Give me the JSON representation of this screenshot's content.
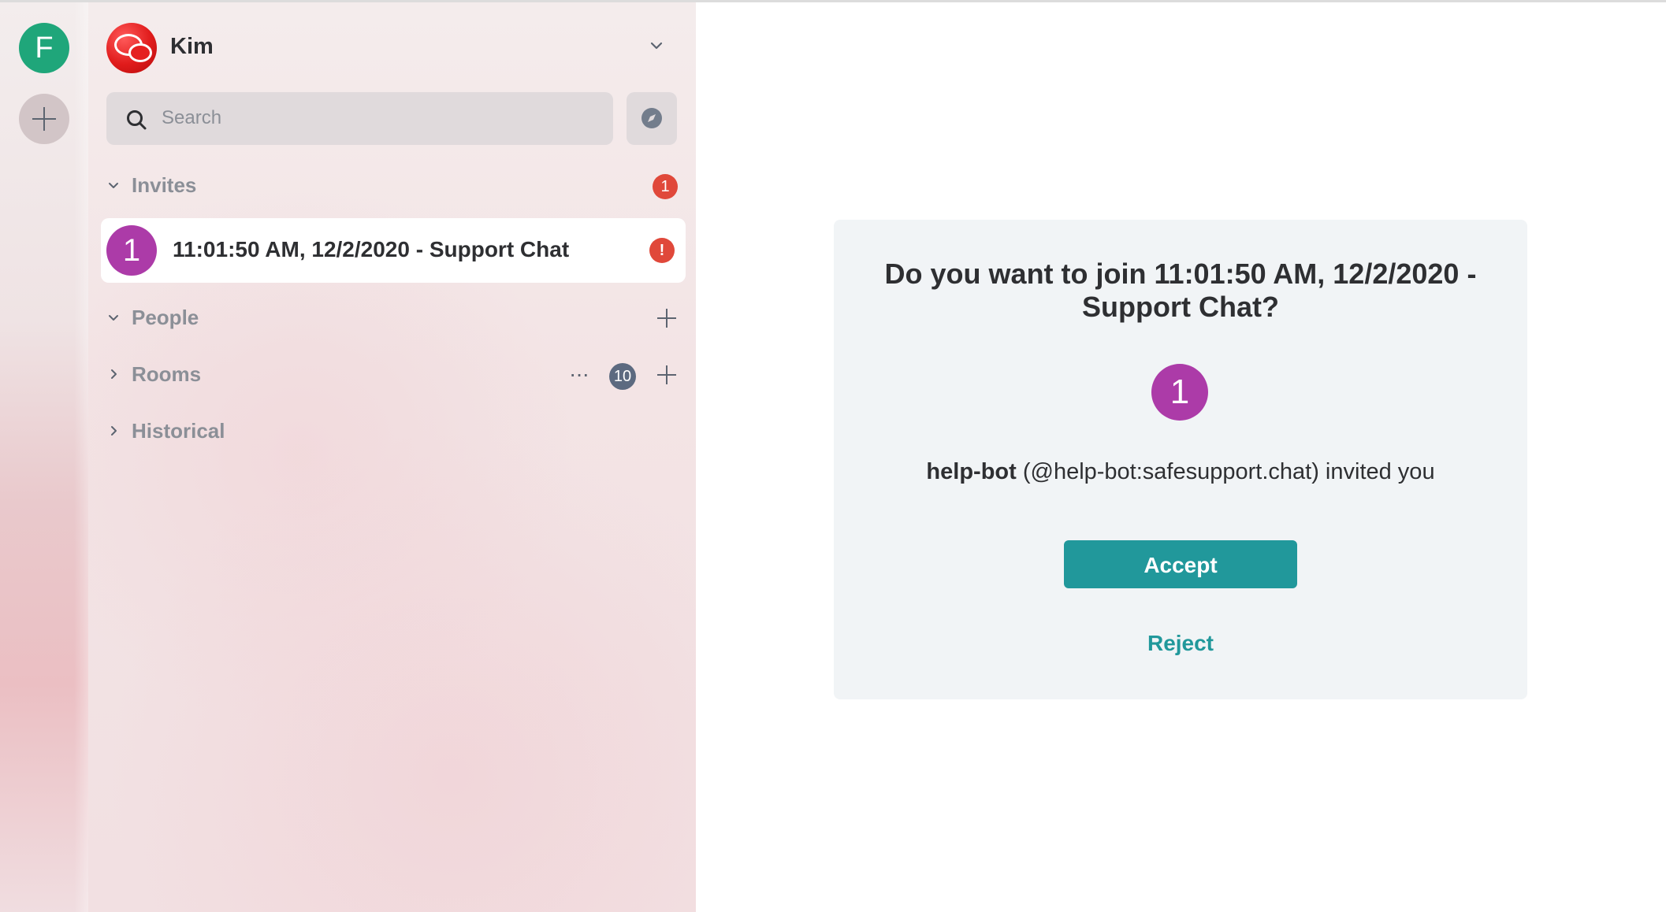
{
  "spaces": {
    "home_initial": "F"
  },
  "user": {
    "name": "Kim"
  },
  "search": {
    "placeholder": "Search"
  },
  "sections": {
    "invites": {
      "label": "Invites",
      "badge": "1"
    },
    "people": {
      "label": "People"
    },
    "rooms": {
      "label": "Rooms",
      "more": "···",
      "count": "10"
    },
    "historical": {
      "label": "Historical"
    }
  },
  "invite_tile": {
    "avatar_initial": "1",
    "name": "11:01:50 AM, 12/2/2020 - Support Chat",
    "alert": "!"
  },
  "invite_card": {
    "title": "Do you want to join 11:01:50 AM, 12/2/2020 - Support Chat?",
    "avatar_initial": "1",
    "inviter_name": "help-bot",
    "inviter_detail": "(@help-bot:safesupport.chat) invited you",
    "accept_label": "Accept",
    "reject_label": "Reject"
  },
  "colors": {
    "accent": "#21989b",
    "space_avatar": "#1fa67a",
    "room_avatar": "#ac3ba8",
    "alert_badge": "#e0483a",
    "count_badge": "#5c6a80"
  },
  "icons": [
    "plus-icon",
    "search-icon",
    "explore-compass-icon",
    "chevron-down-icon",
    "chevron-right-icon",
    "more-icon"
  ]
}
